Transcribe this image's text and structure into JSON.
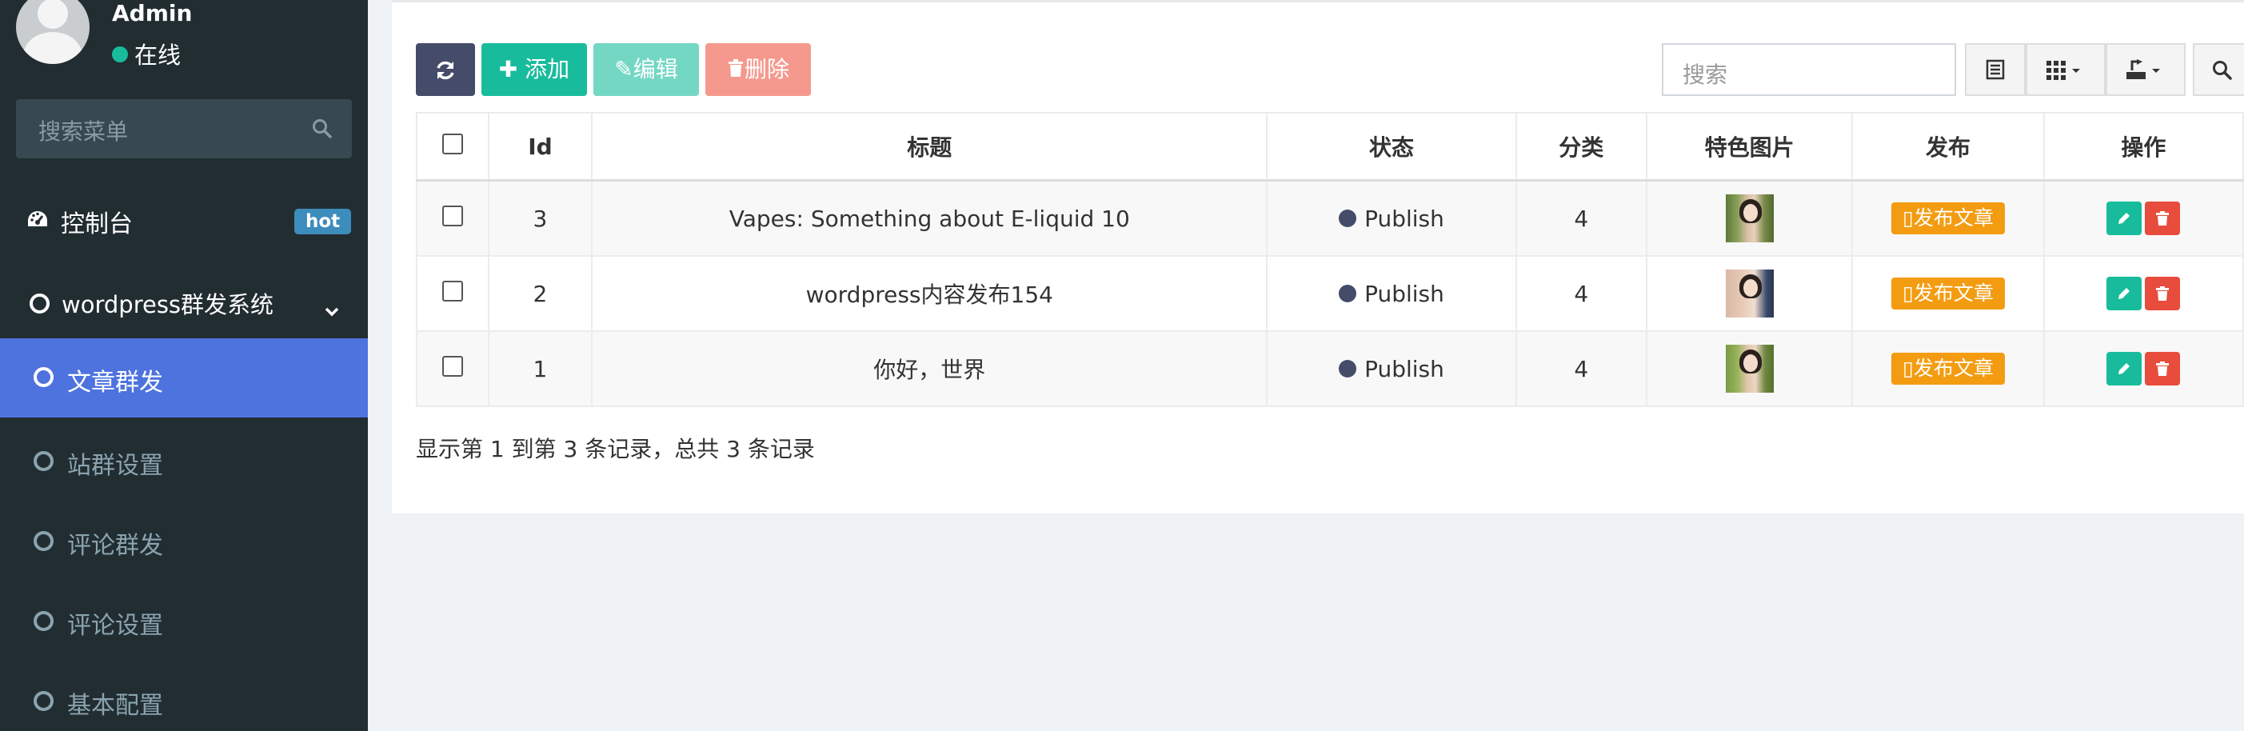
{
  "user": {
    "name": "Admin",
    "status": "在线"
  },
  "sidebar": {
    "search_placeholder": "搜索菜单",
    "dashboard": {
      "label": "控制台",
      "badge": "hot"
    },
    "group": {
      "label": "wordpress群发系统"
    },
    "items": [
      {
        "label": "文章群发",
        "active": true
      },
      {
        "label": "站群设置"
      },
      {
        "label": "评论群发"
      },
      {
        "label": "评论设置"
      },
      {
        "label": "基本配置"
      }
    ]
  },
  "toolbar": {
    "add_label": "添加",
    "edit_label": "编辑",
    "delete_label": "删除",
    "search_placeholder": "搜索"
  },
  "table": {
    "headers": [
      "Id",
      "标题",
      "状态",
      "分类",
      "特色图片",
      "发布",
      "操作"
    ],
    "rows": [
      {
        "id": "3",
        "title": "Vapes: Something about E-liquid 10",
        "status": "Publish",
        "category": "4",
        "publish": "发布文章"
      },
      {
        "id": "2",
        "title": "wordpress内容发布154",
        "status": "Publish",
        "category": "4",
        "publish": "发布文章"
      },
      {
        "id": "1",
        "title": "你好，世界",
        "status": "Publish",
        "category": "4",
        "publish": "发布文章"
      }
    ]
  },
  "pagination": {
    "info": "显示第 1 到第 3 条记录，总共 3 条记录"
  },
  "colors": {
    "sidebar_bg": "#222d32",
    "active_menu": "#4e73df",
    "success": "#18bc9c",
    "warning": "#f39c12",
    "danger": "#e74c3c",
    "primary_dark": "#444c69",
    "hot_badge": "#3c8dbc"
  }
}
